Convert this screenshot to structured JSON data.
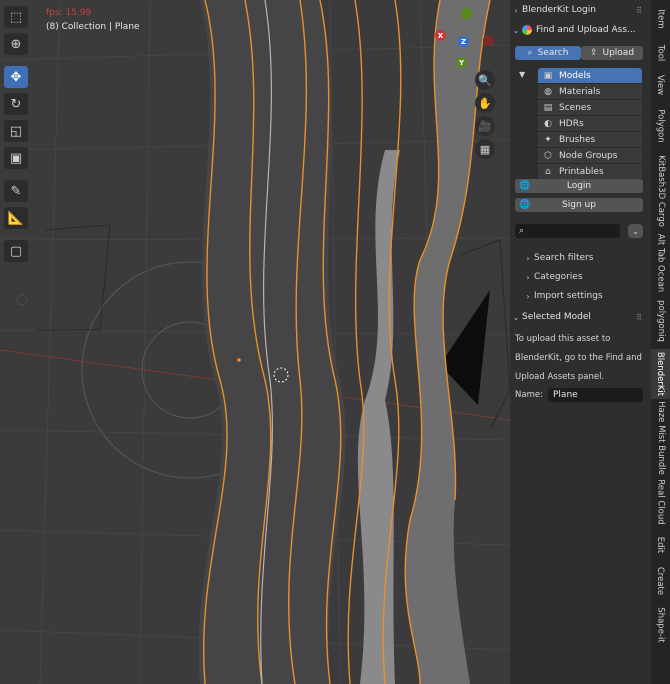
{
  "viewport": {
    "fps_text": "fps: 15.99",
    "collection_text": "(8) Collection | Plane",
    "gizmo_axes": [
      "X",
      "Y",
      "Z"
    ]
  },
  "panel": {
    "login_header": "BlenderKit Login",
    "find_header": "Find and Upload Ass...",
    "search_button": "Search",
    "upload_button": "Upload",
    "asset_types": [
      "Models",
      "Materials",
      "Scenes",
      "HDRs",
      "Brushes",
      "Node Groups",
      "Printables"
    ],
    "login_button": "Login",
    "signup_button": "Sign up",
    "search_value": "",
    "search_filters": "Search filters",
    "categories": "Categories",
    "import_settings": "Import settings",
    "selected_model_header": "Selected Model",
    "upload_desc_lines": [
      "To upload this asset to",
      "BlenderKit, go to the Find and",
      "Upload Assets panel."
    ],
    "name_label": "Name:",
    "name_value": "Plane"
  },
  "tabs": [
    "Item",
    "Tool",
    "View",
    "Polygon",
    "KitBash3D Cargo",
    "Alt Tab Ocean",
    "polygoniq",
    "BlenderKit",
    "Haze Mist Bundle",
    "Real Cloud",
    "Edit",
    "Create",
    "Shape-it"
  ],
  "colors": {
    "accent": "#4772b3",
    "selected_outline": "#e8902a",
    "fps": "#c8423a"
  }
}
